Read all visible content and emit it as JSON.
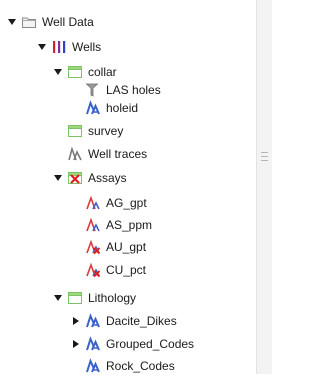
{
  "tree": {
    "nodes": [
      {
        "label": "Well Data",
        "expander": "expanded",
        "icon": "folder-icon"
      },
      {
        "label": "Wells",
        "expander": "expanded",
        "icon": "wells-icon"
      },
      {
        "label": "collar",
        "expander": "expanded",
        "icon": "table-icon"
      },
      {
        "label": "LAS holes",
        "expander": "none",
        "icon": "las-holes-icon"
      },
      {
        "label": "holeid",
        "expander": "none",
        "icon": "category-column-icon"
      },
      {
        "label": "survey",
        "expander": "none",
        "icon": "table-icon"
      },
      {
        "label": "Well traces",
        "expander": "none",
        "icon": "well-traces-icon"
      },
      {
        "label": "Assays",
        "expander": "expanded",
        "icon": "assays-table-icon"
      },
      {
        "label": "AG_gpt",
        "expander": "none",
        "icon": "numeric-column-icon"
      },
      {
        "label": "AS_ppm",
        "expander": "none",
        "icon": "numeric-column-icon"
      },
      {
        "label": "AU_gpt",
        "expander": "none",
        "icon": "numeric-column-error-icon"
      },
      {
        "label": "CU_pct",
        "expander": "none",
        "icon": "numeric-column-error-icon"
      },
      {
        "label": "Lithology",
        "expander": "expanded",
        "icon": "table-icon"
      },
      {
        "label": "Dacite_Dikes",
        "expander": "collapsed",
        "icon": "category-column-icon"
      },
      {
        "label": "Grouped_Codes",
        "expander": "collapsed",
        "icon": "category-column-icon"
      },
      {
        "label": "Rock_Codes",
        "expander": "none",
        "icon": "category-column-icon"
      }
    ]
  }
}
